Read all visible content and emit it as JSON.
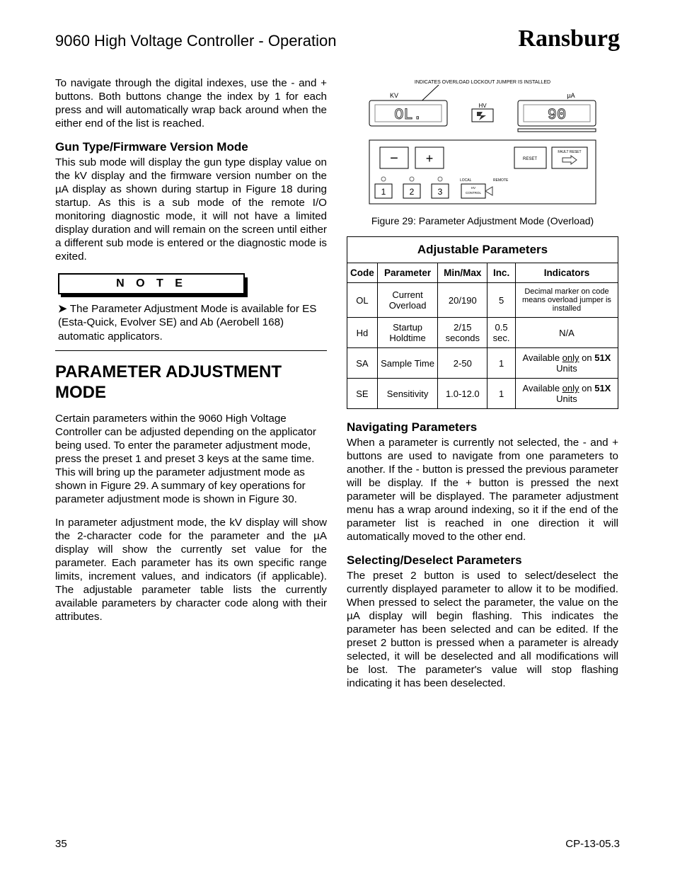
{
  "header": {
    "title": "9060 High Voltage Controller - Operation",
    "brand": "Ransburg"
  },
  "left": {
    "p1": "To navigate through the digital indexes, use the - and + buttons.  Both buttons change the index by 1 for each press and will automatically wrap back around when the either end of the list is reached.",
    "h_gun": "Gun Type/Firmware Version Mode",
    "p_gun": "This sub mode will display the gun type display value on the kV display and the firmware version number on the µA display as shown during startup in Figure 18 during startup.  As this is a sub mode of the remote I/O monitoring diagnostic mode, it will not have a limited display duration and will remain on the screen until either a different sub mode is entered or the diagnostic mode is exited.",
    "note_title": "N O T E",
    "note_body": "The Parameter Adjustment Mode is available for ES (Esta-Quick, Evolver SE) and Ab (Aerobell 168) automatic applicators.",
    "h_param": "PARAMETER ADJUSTMENT MODE",
    "p_param1": "Certain parameters within the 9060 High Voltage Controller can be adjusted depending on the applicator being used.  To enter the parameter adjustment mode, press the preset 1 and preset 3 keys at the same  time.  This will bring up the parameter adjustment mode as shown in Figure 29.  A summary of key operations for parameter adjustment mode is shown in Figure 30.",
    "p_param2": "In parameter adjustment mode, the kV display will show the 2-character code for the parameter and the µA display will show the currently set value for the parameter.  Each parameter has its own specific range limits, increment values, and indicators (if applicable).   The adjustable parameter table lists the currently available parameters by character code along with their attributes."
  },
  "figure": {
    "overload_label": "INDICATES OVERLOAD LOCKOUT JUMPER IS INSTALLED",
    "kv_label": "KV",
    "ua_label": "µA",
    "hv_label": "HV",
    "kv_value": "OL.",
    "ua_value": "90",
    "minus": "−",
    "plus": "+",
    "reset": "RESET",
    "fault_reset": "FAULT RESET",
    "btn1": "1",
    "btn2": "2",
    "btn3": "3",
    "hv_control": "HV CONTROL",
    "caption": "Figure 29: Parameter Adjustment Mode (Overload)"
  },
  "table": {
    "title": "Adjustable Parameters",
    "headers": [
      "Code",
      "Parameter",
      "Min/Max",
      "Inc.",
      "Indicators"
    ],
    "rows": [
      {
        "code": "OL",
        "param": "Current Overload",
        "minmax": "20/190",
        "inc": "5",
        "ind": "Decimal marker on code means overload jumper is installed"
      },
      {
        "code": "Hd",
        "param": "Startup Holdtime",
        "minmax": "2/15 seconds",
        "inc": "0.5 sec.",
        "ind": "N/A"
      },
      {
        "code": "SA",
        "param": "Sample Time",
        "minmax": "2-50",
        "inc": "1",
        "ind_prefix": "Available ",
        "ind_u": "only",
        "ind_suffix1": " on ",
        "ind_bold": "51X",
        "ind_suffix2": " Units"
      },
      {
        "code": "SE",
        "param": "Sensitivity",
        "minmax": "1.0-12.0",
        "inc": "1",
        "ind_prefix": "Available ",
        "ind_u": "only",
        "ind_suffix1": " on ",
        "ind_bold": "51X",
        "ind_suffix2": " Units"
      }
    ]
  },
  "right": {
    "h_nav": "Navigating Parameters",
    "p_nav": "When a parameter is currently not selected, the - and + buttons are used to navigate from one parameters to another.   If the - button is pressed the previous parameter will be display.  If the + button is pressed the next parameter will be displayed.  The parameter adjustment menu has a wrap around indexing, so it if the end of the parameter list is reached in one direction it will automatically moved to the other end.",
    "h_sel": "Selecting/Deselect Parameters",
    "p_sel": "The preset 2 button is used to select/deselect the currently displayed parameter to allow it to be modified.   When pressed to select the parameter, the value on the µA display will begin flashing.  This indicates the parameter has been selected and can be edited.  If the preset 2 button is pressed when a parameter is already selected, it will be deselected and all modifications will be lost.   The parameter's value will stop flashing indicating it has been deselected."
  },
  "footer": {
    "page": "35",
    "doc": "CP-13-05.3"
  }
}
